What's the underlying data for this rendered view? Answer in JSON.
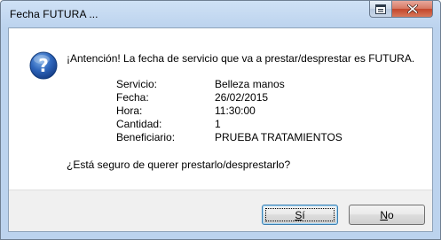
{
  "window": {
    "title": "Fecha FUTURA ..."
  },
  "titlebar_buttons": {
    "help_icon": "window-menu-icon",
    "close_icon": "close-icon"
  },
  "dialog": {
    "icon": "question-icon",
    "message": "¡Antención! La fecha de servicio que va a prestar/desprestar es FUTURA.",
    "details": [
      {
        "label": "Servicio:",
        "value": "Belleza manos"
      },
      {
        "label": "Fecha:",
        "value": "26/02/2015"
      },
      {
        "label": "Hora:",
        "value": "11:30:00"
      },
      {
        "label": "Cantidad:",
        "value": "1"
      },
      {
        "label": "Beneficiario:",
        "value": "PRUEBA TRATAMIENTOS"
      }
    ],
    "question": "¿Está seguro de querer prestarlo/desprestarlo?"
  },
  "buttons": {
    "yes": {
      "mnemonic": "S",
      "rest": "í"
    },
    "no": {
      "mnemonic": "N",
      "rest": "o"
    }
  },
  "colors": {
    "close_button": "#c3462b",
    "icon_blue": "#2b59a8",
    "default_button_border": "#3c7fb1"
  }
}
